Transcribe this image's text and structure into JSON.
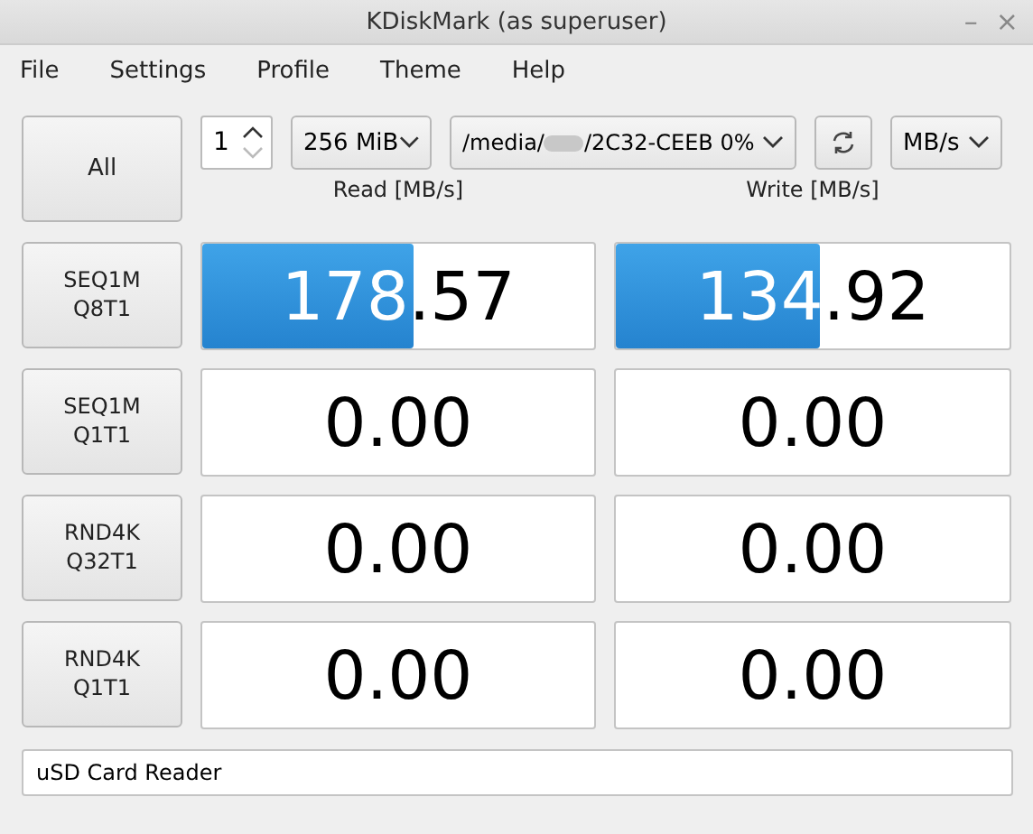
{
  "window": {
    "title": "KDiskMark (as superuser)",
    "controls": [
      "–",
      "×"
    ]
  },
  "menu": [
    "File",
    "Settings",
    "Profile",
    "Theme",
    "Help"
  ],
  "toolbar": {
    "all_button": "All",
    "runs": "1",
    "size": "256 MiB",
    "path_start": "/media/",
    "path_end": "/2C32-CEEB 0%",
    "unit": "MB/s"
  },
  "headers": {
    "read": "Read [MB/s]",
    "write": "Write [MB/s]"
  },
  "rows": [
    {
      "test": [
        "SEQ1M",
        "Q8T1"
      ],
      "read": {
        "value": "178.57",
        "level": 0.54
      },
      "write": {
        "value": "134.92",
        "level": 0.52
      }
    },
    {
      "test": [
        "SEQ1M",
        "Q1T1"
      ],
      "read": {
        "value": "0.00"
      },
      "write": {
        "value": "0.00"
      }
    },
    {
      "test": [
        "RND4K",
        "Q32T1"
      ],
      "read": {
        "value": "0.00"
      },
      "write": {
        "value": "0.00"
      }
    },
    {
      "test": [
        "RND4K",
        "Q1T1"
      ],
      "read": {
        "value": "0.00"
      },
      "write": {
        "value": "0.00"
      }
    }
  ],
  "status": "uSD Card Reader"
}
